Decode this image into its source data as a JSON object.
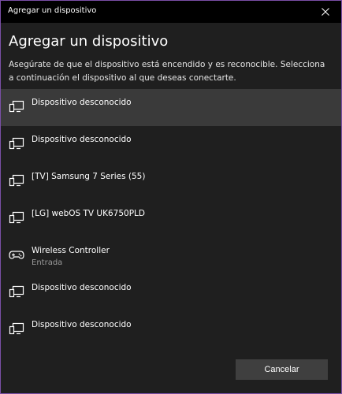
{
  "window": {
    "title": "Agregar un dispositivo",
    "heading": "Agregar un dispositivo",
    "description": "Asegúrate de que el dispositivo está encendido y es reconocible. Selecciona a continuación el dispositivo al que deseas conectarte."
  },
  "devices": [
    {
      "name": "Dispositivo desconocido",
      "icon": "display-device-icon"
    },
    {
      "name": "Dispositivo desconocido",
      "icon": "display-device-icon"
    },
    {
      "name": "[TV] Samsung 7 Series (55)",
      "icon": "display-device-icon"
    },
    {
      "name": "[LG] webOS TV UK6750PLD",
      "icon": "display-device-icon"
    },
    {
      "name": "Wireless Controller",
      "subtitle": "Entrada",
      "icon": "gamepad-icon"
    },
    {
      "name": "Dispositivo desconocido",
      "icon": "display-device-icon"
    },
    {
      "name": "Dispositivo desconocido",
      "icon": "display-device-icon"
    }
  ],
  "buttons": {
    "cancel": "Cancelar"
  },
  "colors": {
    "background": "#1f1f1f",
    "titlebar": "#000000",
    "selected_row": "#3a3a3a",
    "button": "#3f3f3f",
    "window_border": "#7a4fa6"
  }
}
